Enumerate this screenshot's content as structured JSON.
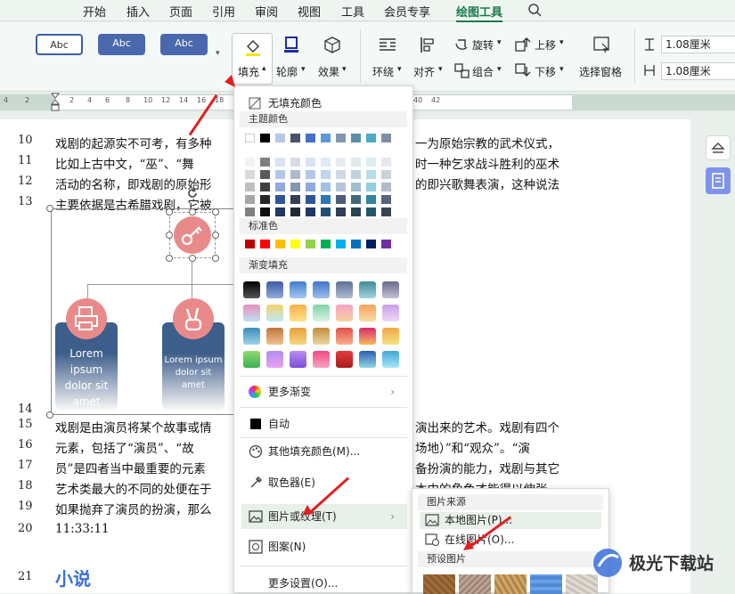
{
  "tabs": [
    "开始",
    "插入",
    "页面",
    "引用",
    "审阅",
    "视图",
    "工具",
    "会员专享",
    "绘图工具"
  ],
  "ribbon": {
    "styles": [
      "Abc",
      "Abc",
      "Abc"
    ],
    "fill": "填充",
    "outline": "轮廓",
    "effect": "效果",
    "wrap": "环绕",
    "align": "对齐",
    "rotate": "旋转",
    "group": "组合",
    "up": "上移",
    "down": "下移",
    "selpane": "选择窗格",
    "height": "1.08厘米",
    "width": "1.08厘米"
  },
  "ruler": [
    "4",
    "2",
    "2",
    "4",
    "6",
    "8",
    "10",
    "12",
    "14",
    "16",
    "18",
    "20",
    "22",
    "24",
    "26",
    "28",
    "30",
    "32",
    "34",
    "36",
    "38",
    "40",
    "42"
  ],
  "doc": {
    "lines": [
      {
        "n": "10",
        "t": "戏剧的起源实不可考，有多种",
        "t2": "一为原始宗教的武术仪式，"
      },
      {
        "n": "11",
        "t": "比如上古中文，“巫”、“舞",
        "t2": "时一种乞求战斗胜利的巫术"
      },
      {
        "n": "12",
        "t": "活动的名称，即戏剧的原始形",
        "t2": "的即兴歌舞表演，这种说法"
      },
      {
        "n": "13",
        "t": "主要依据是古希腊戏剧，它被",
        "t2": ""
      },
      {
        "n": "14",
        "t": "",
        "t2": ""
      },
      {
        "n": "15",
        "t": "戏剧是由演员将某个故事或情",
        "t2": "演出来的艺术。戏剧有四个"
      },
      {
        "n": "16",
        "t": "元素，包括了“演员”、“故",
        "t2": "场地）”和“观众”。“演"
      },
      {
        "n": "17",
        "t": "员”是四者当中最重要的元素",
        "t2": "备扮演的能力，戏剧与其它"
      },
      {
        "n": "18",
        "t": "艺术类最大的不同的处便在于",
        "t2": "本中的角色才能得以伸张，"
      },
      {
        "n": "19",
        "t": "如果抛弃了演员的扮演，那么",
        "t2": ""
      },
      {
        "n": "20",
        "t": "11:33:11",
        "t2": ""
      },
      {
        "n": "21",
        "t": "小说",
        "t2": ""
      }
    ],
    "card1": "Lorem ipsum dolor sit amet",
    "card2": "Lorem ipsum dolor sit amet"
  },
  "menu": {
    "no_fill": "无填充颜色",
    "theme": "主题颜色",
    "standard": "标准色",
    "gradient": "渐变填充",
    "more_grad": "更多渐变",
    "auto": "自动",
    "other": "其他填充颜色(M)...",
    "picker": "取色器(E)",
    "picture": "图片或纹理(T)",
    "pattern": "图案(N)",
    "more": "更多设置(O)..."
  },
  "submenu": {
    "source": "图片来源",
    "local": "本地图片(P)...",
    "online": "在线图片(O)...",
    "preset": "预设图片"
  },
  "watermark": "极光下载站",
  "colors": {
    "accent": "#1a7a4c",
    "standard": [
      "#c00000",
      "#ff0000",
      "#ffc000",
      "#ffff00",
      "#92d050",
      "#00b050",
      "#00b0f0",
      "#0070c0",
      "#002060",
      "#7030a0"
    ]
  }
}
